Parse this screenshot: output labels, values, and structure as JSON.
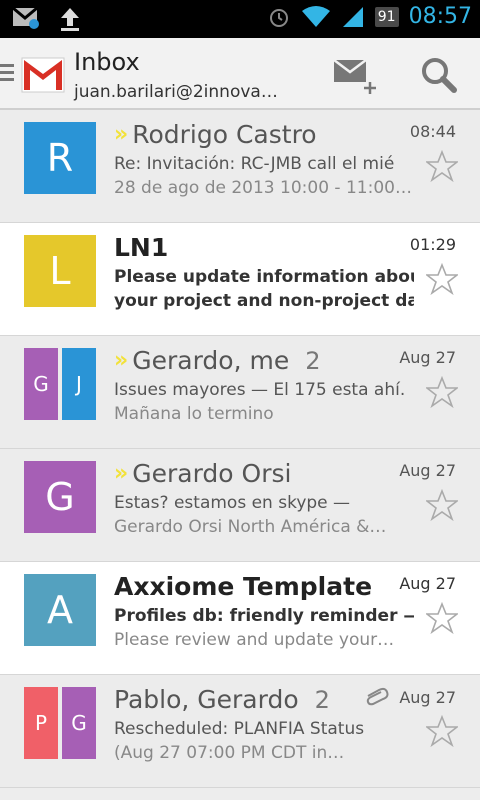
{
  "status_bar": {
    "battery": "91",
    "time": "08:57"
  },
  "header": {
    "title": "Inbox",
    "account": "juan.barilari@2innova…"
  },
  "colors": {
    "blue": "#2a94d6",
    "yellow": "#e5c82b",
    "purple": "#a65fb5",
    "teal": "#54a1bf",
    "red": "#f06068",
    "chevron": "#f2e23a"
  },
  "emails": [
    {
      "sender": "Rodrigo Castro",
      "count": "",
      "time": "08:44",
      "line1": "Re: Invitación: RC-JMB call el mié",
      "line2": "28 de ago de 2013 10:00 - 11:00…",
      "avatars": [
        {
          "letter": "R",
          "color": "blue"
        }
      ],
      "important": true,
      "unread": false,
      "attachment": false
    },
    {
      "sender": "LN1",
      "count": "",
      "time": "01:29",
      "line1": "Please update information about",
      "line2": "your project and non-project day…",
      "avatars": [
        {
          "letter": "L",
          "color": "yellow"
        }
      ],
      "important": false,
      "unread": true,
      "attachment": false
    },
    {
      "sender": "Gerardo, me",
      "count": "2",
      "time": "Aug 27",
      "line1": "Issues mayores — El 175 esta ahí.",
      "line2": "Mañana lo termino",
      "avatars": [
        {
          "letter": "G",
          "color": "purple"
        },
        {
          "letter": "J",
          "color": "blue"
        }
      ],
      "important": true,
      "unread": false,
      "attachment": false
    },
    {
      "sender": "Gerardo Orsi",
      "count": "",
      "time": "Aug 27",
      "line1": "Estas? estamos en skype —",
      "line2": "Gerardo Orsi North América &…",
      "avatars": [
        {
          "letter": "G",
          "color": "purple"
        }
      ],
      "important": true,
      "unread": false,
      "attachment": false
    },
    {
      "sender": "Axxiome Template",
      "count": "",
      "time": "Aug 27",
      "line1": "Profiles db: friendly reminder —",
      "line2": "Please review and update your…",
      "avatars": [
        {
          "letter": "A",
          "color": "teal"
        }
      ],
      "important": false,
      "unread": true,
      "attachment": false
    },
    {
      "sender": "Pablo, Gerardo",
      "count": "2",
      "time": "Aug 27",
      "line1": "Rescheduled: PLANFIA Status",
      "line2": "(Aug 27 07:00 PM CDT in…",
      "avatars": [
        {
          "letter": "P",
          "color": "red"
        },
        {
          "letter": "G",
          "color": "purple"
        }
      ],
      "important": false,
      "unread": false,
      "attachment": true
    }
  ]
}
